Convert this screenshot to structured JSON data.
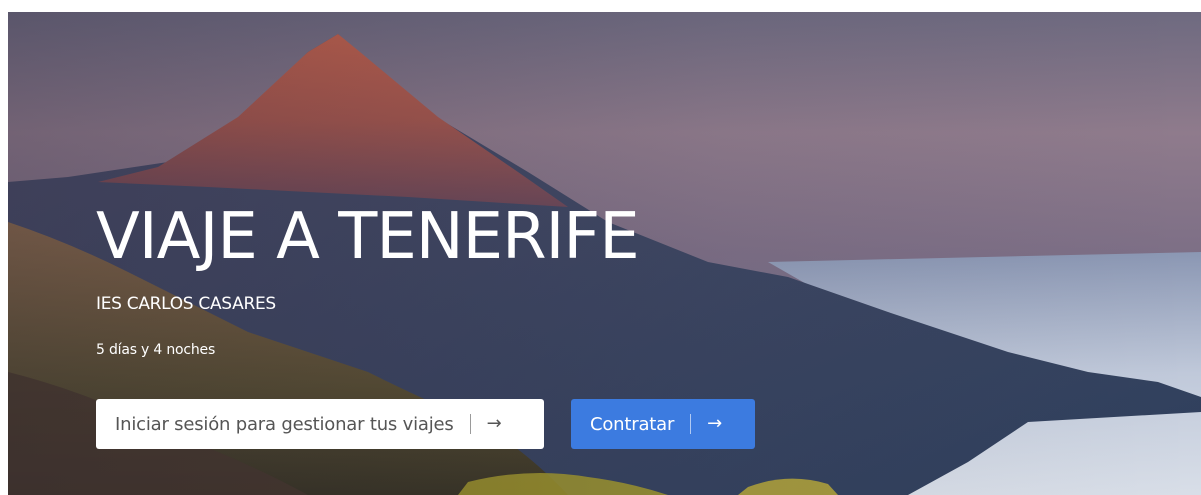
{
  "hero": {
    "title": "VIAJE A TENERIFE",
    "subtitle": "IES CARLOS CASARES",
    "duration": "5 días y 4 noches",
    "background_icon": "mountain-landscape-image"
  },
  "actions": {
    "login_label": "Iniciar sesión para gestionar tus viajes",
    "contract_label": "Contratar",
    "arrow_glyph": "→",
    "arrow_icon": "arrow-right-icon"
  },
  "colors": {
    "primary_button": "#3c7be0",
    "secondary_button": "#ffffff",
    "text_on_hero": "#ffffff"
  }
}
